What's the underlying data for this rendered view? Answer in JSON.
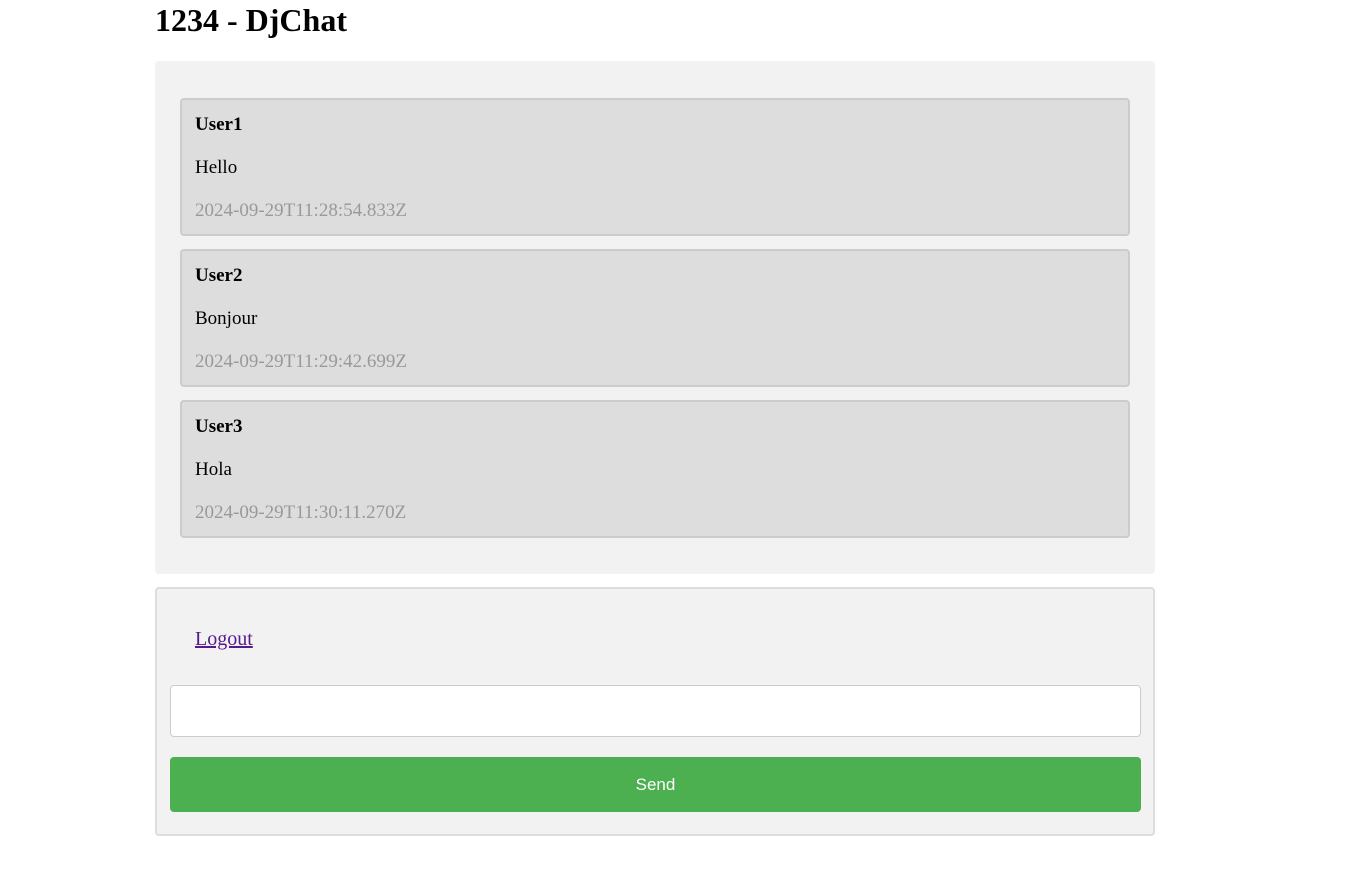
{
  "page": {
    "title": "1234 - DjChat"
  },
  "messages": [
    {
      "author": "User1",
      "text": "Hello",
      "timestamp": "2024-09-29T11:28:54.833Z"
    },
    {
      "author": "User2",
      "text": "Bonjour",
      "timestamp": "2024-09-29T11:29:42.699Z"
    },
    {
      "author": "User3",
      "text": "Hola",
      "timestamp": "2024-09-29T11:30:11.270Z"
    }
  ],
  "controls": {
    "logout_label": "Logout",
    "input_value": "",
    "send_label": "Send"
  },
  "colors": {
    "send_button": "#4caf50",
    "message_background": "#dddddd",
    "panel_background": "#f2f2f2",
    "timestamp_text": "#999999",
    "visited_link": "#551a8b"
  }
}
